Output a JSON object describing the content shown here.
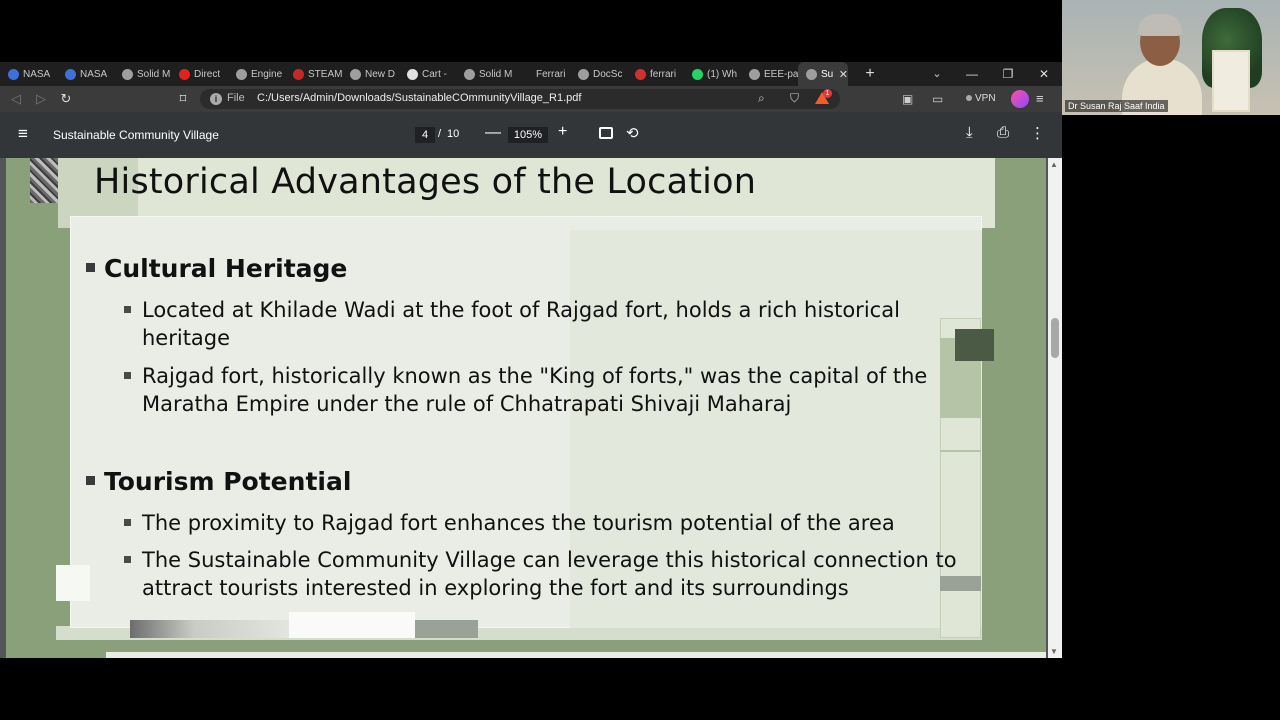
{
  "browser": {
    "tabs": [
      {
        "label": "NASA",
        "color": "#3f6fd8"
      },
      {
        "label": "NASA",
        "color": "#3f6fd8"
      },
      {
        "label": "Solid M",
        "color": "#9e9e9e"
      },
      {
        "label": "Direct",
        "color": "#e62117"
      },
      {
        "label": "Engine",
        "color": "#9e9e9e"
      },
      {
        "label": "STEAM",
        "color": "#c62828"
      },
      {
        "label": "New D",
        "color": "#9e9e9e"
      },
      {
        "label": "Cart -",
        "color": "#e0e0e0"
      },
      {
        "label": "Solid M",
        "color": "#9e9e9e"
      },
      {
        "label": "Ferrari",
        "color": "#1f1f1f"
      },
      {
        "label": "DocSc",
        "color": "#9e9e9e"
      },
      {
        "label": "ferrari",
        "color": "#d32f2f"
      },
      {
        "label": "(1) Wh",
        "color": "#25d366"
      },
      {
        "label": "EEE-pa",
        "color": "#9e9e9e"
      }
    ],
    "active_tab": {
      "label": "Su",
      "color": "#9e9e9e"
    },
    "new_tab_glyph": "+",
    "url_scheme": "File",
    "url": "C:/Users/Admin/Downloads/SustainableCOmmunityVillage_R1.pdf",
    "vpn_label": "VPN",
    "rewards_badge": "1"
  },
  "pdf": {
    "title": "Sustainable Community Village",
    "current_page": "4",
    "page_separator": "/",
    "total_pages": "10",
    "zoom": "105%"
  },
  "slide": {
    "title": "Historical Advantages of the Location",
    "sections": [
      {
        "heading": "Cultural Heritage",
        "bullets": [
          "Located at Khilade Wadi at the foot of Rajgad fort, holds a rich historical heritage",
          "Rajgad fort, historically known as the \"King of forts,\" was the capital of the Maratha Empire under the rule of Chhatrapati Shivaji Maharaj"
        ]
      },
      {
        "heading": "Tourism Potential",
        "bullets": [
          "The proximity to Rajgad fort enhances the tourism potential of the area",
          "The Sustainable Community Village can leverage this historical connection to attract tourists interested in exploring the fort and its surroundings"
        ]
      }
    ]
  },
  "webcam": {
    "participant_name": "Dr Susan Raj Saaf India"
  }
}
